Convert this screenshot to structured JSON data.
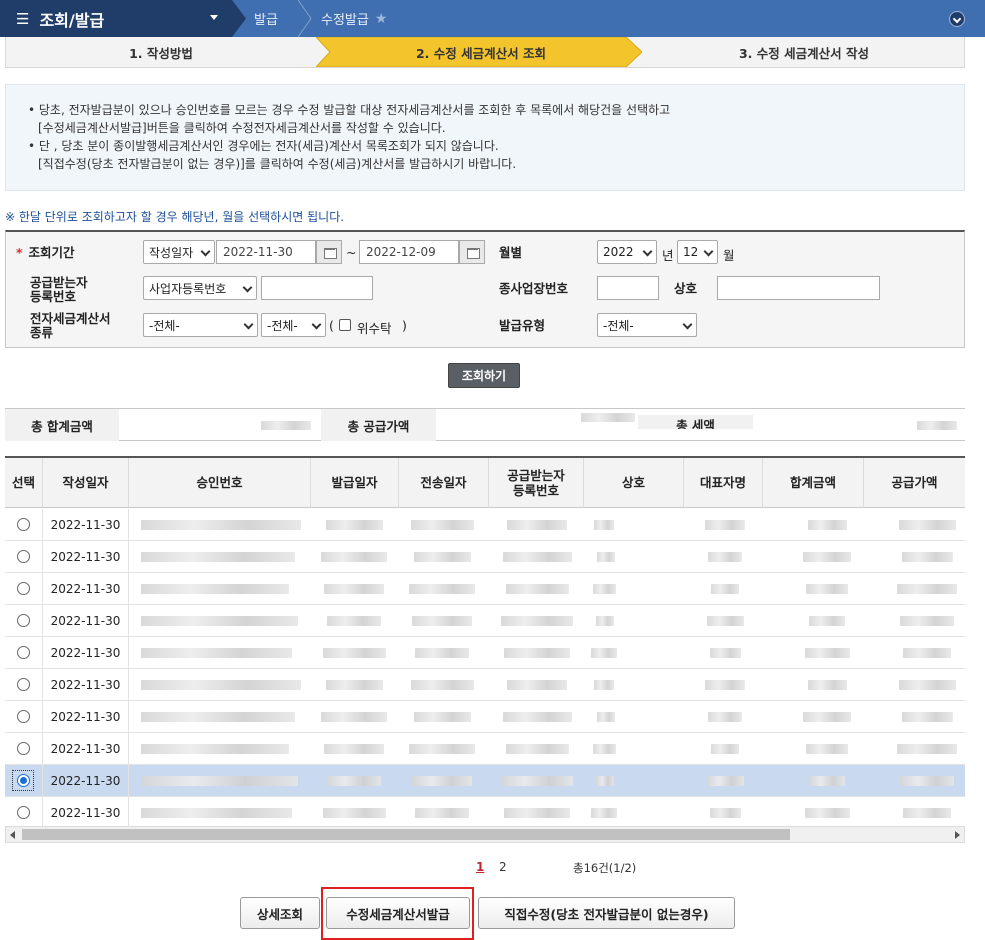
{
  "nav": {
    "menu_title": "조회/발급",
    "crumbs": [
      "발급",
      "수정발급"
    ],
    "colors": {
      "dark": "#203d6a",
      "blue": "#3f6fb0"
    }
  },
  "steps": [
    "1. 작성방법",
    "2. 수정 세금계산서 조회",
    "3. 수정 세금계산서 작성"
  ],
  "notice": {
    "lines": [
      "• 당초, 전자발급분이 있으나 승인번호를 모르는 경우 수정 발급할 대상 전자세금계산서를 조회한 후 목록에서 해당건을 선택하고",
      "[수정세금계산서발급]버튼을 클릭하여 수정전자세금계산서를 작성할 수 있습니다.",
      "• 단 , 당초 분이 종이발행세금계산서인 경우에는 전자(세금)계산서 목록조회가 되지 않습니다.",
      "[직접수정(당초 전자발급분이 없는 경우)]를 클릭하여 수정(세금)계산서를 발급하시기 바랍니다."
    ]
  },
  "tip": "※ 한달 단위로 조회하고자 할 경우 해당년, 월을 선택하시면 됩니다.",
  "search": {
    "period_label": "조회기간",
    "date_type": "작성일자",
    "date_from": "2022-11-30",
    "tilde": "~",
    "date_to": "2022-12-09",
    "month_label": "월별",
    "year": "2022",
    "year_unit": "년",
    "month": "12",
    "month_unit": "월",
    "buyer_reg_label": "공급받는자\n등록번호",
    "buyer_reg_type": "사업자등록번호",
    "sub_biz_label": "종사업장번호",
    "company_label": "상호",
    "invoice_type_label": "전자세금계산서\n종류",
    "invoice_type_1": "-전체-",
    "invoice_type_2": "-전체-",
    "consign_label": "위수탁",
    "paren_open": "(",
    "paren_close": ")",
    "issue_type_label": "발급유형",
    "issue_type": "-전체-",
    "submit": "조회하기"
  },
  "totals": {
    "total_label": "총 합계금액",
    "supply_label": "총 공급가액",
    "tax_label": "총 세액"
  },
  "table": {
    "headers": [
      "선택",
      "작성일자",
      "승인번호",
      "발급일자",
      "전송일자",
      "공급받는자\n등록번호",
      "상호",
      "대표자명",
      "합계금액",
      "공급가액"
    ],
    "rows": [
      {
        "date": "2022-11-30",
        "selected": false
      },
      {
        "date": "2022-11-30",
        "selected": false
      },
      {
        "date": "2022-11-30",
        "selected": false
      },
      {
        "date": "2022-11-30",
        "selected": false
      },
      {
        "date": "2022-11-30",
        "selected": false
      },
      {
        "date": "2022-11-30",
        "selected": false
      },
      {
        "date": "2022-11-30",
        "selected": false
      },
      {
        "date": "2022-11-30",
        "selected": false
      },
      {
        "date": "2022-11-30",
        "selected": true
      },
      {
        "date": "2022-11-30",
        "selected": false
      }
    ]
  },
  "pagination": {
    "current": "1",
    "next": "2",
    "count": "총16건(1/2)"
  },
  "buttons": {
    "detail": "상세조회",
    "issue_modified": "수정세금계산서발급",
    "direct_modify": "직접수정(당초 전자발급분이 없는경우)"
  }
}
